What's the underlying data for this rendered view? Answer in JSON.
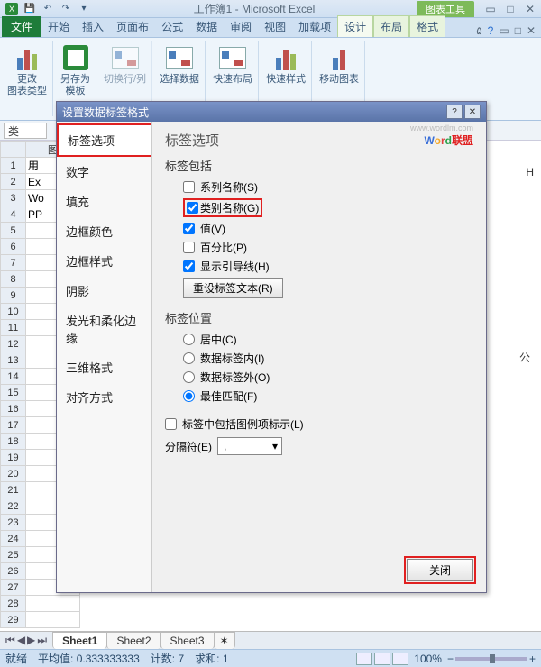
{
  "app": {
    "title": "工作簿1 - Microsoft Excel",
    "context_tool": "图表工具"
  },
  "tabs": {
    "file": "文件",
    "home": "开始",
    "insert": "插入",
    "layout": "页面布",
    "formulas": "公式",
    "data": "数据",
    "review": "审阅",
    "view": "视图",
    "addins": "加载项",
    "design": "设计",
    "layout2": "布局",
    "format": "格式"
  },
  "ribbon": {
    "change_type": "更改\n图表类型",
    "save_as": "另存为\n模板",
    "switch_rc": "切换行/列",
    "select_data": "选择数据",
    "quick_layout": "快速布局",
    "quick_style": "快速样式",
    "move_chart": "移动图表"
  },
  "formula_bar": {
    "label": "类"
  },
  "cells": {
    "a1": "用",
    "a2": "Ex",
    "a3": "Wo",
    "a4": "PP",
    "h_col": "H"
  },
  "dialog": {
    "title": "设置数据标签格式",
    "nav": [
      "标签选项",
      "数字",
      "填充",
      "边框颜色",
      "边框样式",
      "阴影",
      "发光和柔化边缘",
      "三维格式",
      "对齐方式"
    ],
    "heading": "标签选项",
    "label_contains": "标签包括",
    "series_name": "系列名称(S)",
    "category_name": "类别名称(G)",
    "value": "值(V)",
    "percentage": "百分比(P)",
    "leader_lines": "显示引导线(H)",
    "reset_btn": "重设标签文本(R)",
    "label_position": "标签位置",
    "center": "居中(C)",
    "inside_end": "数据标签内(I)",
    "outside_end": "数据标签外(O)",
    "best_fit": "最佳匹配(F)",
    "include_legend": "标签中包括图例项标示(L)",
    "separator": "分隔符(E)",
    "separator_val": ",",
    "close": "关闭",
    "watermark_url": "www.wordlm.com"
  },
  "sheets": {
    "s1": "Sheet1",
    "s2": "Sheet2",
    "s3": "Sheet3"
  },
  "status": {
    "ready": "就绪",
    "avg_lbl": "平均值:",
    "avg": "0.333333333",
    "count_lbl": "计数:",
    "count": "7",
    "sum_lbl": "求和:",
    "sum": "1",
    "zoom": "100%"
  }
}
